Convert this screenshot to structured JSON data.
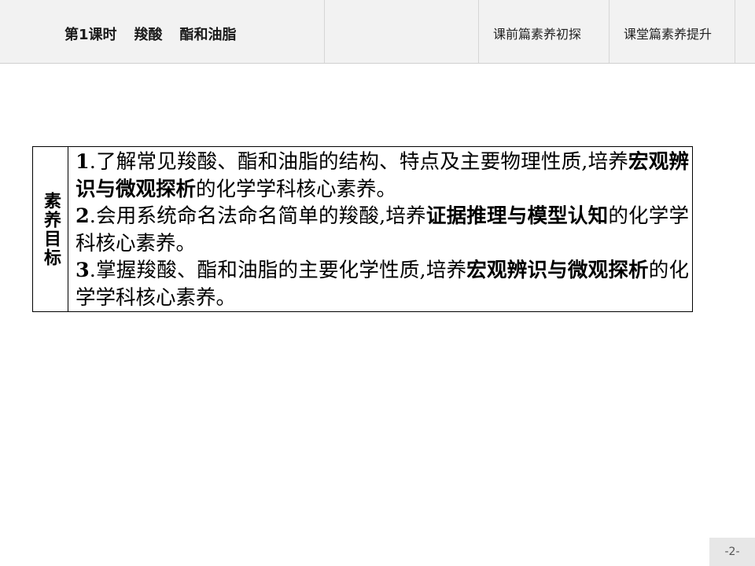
{
  "header": {
    "lesson_title": {
      "lesson": "第1课时",
      "topic1": "羧酸",
      "topic2": "酯和油脂"
    },
    "tabs": [
      {
        "label": "课前篇素养初探"
      },
      {
        "label": "课堂篇素养提升"
      }
    ]
  },
  "goals": {
    "label": "素养目标",
    "items": [
      {
        "num": "1",
        "pre": ".了解常见羧酸、酯和油脂的结构、特点及主要物理性质,培养",
        "em": "宏观辨识与微观探析",
        "post": "的化学学科核心素养。"
      },
      {
        "num": "2",
        "pre": ".会用系统命名法命名简单的羧酸,培养",
        "em": "证据推理与模型认知",
        "post": "的化学学科核心素养。"
      },
      {
        "num": "3",
        "pre": ".掌握羧酸、酯和油脂的主要化学性质,培养",
        "em": "宏观辨识与微观探析",
        "post": "的化学学科核心素养。"
      }
    ]
  },
  "page_number": "-2-"
}
